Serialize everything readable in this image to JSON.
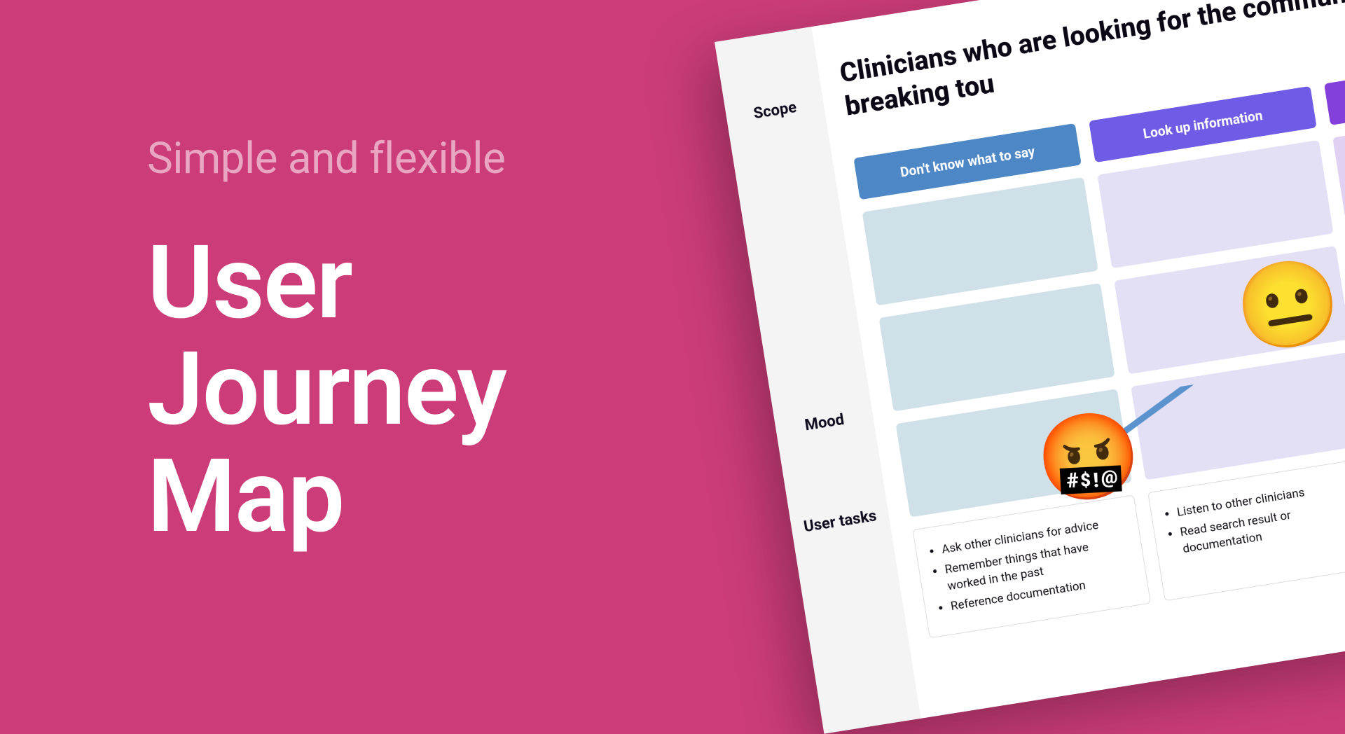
{
  "left": {
    "subtitle": "Simple and flexible",
    "title_l1": "User",
    "title_l2": "Journey",
    "title_l3": "Map"
  },
  "sidebar": {
    "scope": "Scope",
    "mood": "Mood",
    "tasks": "User tasks"
  },
  "scope_text": "Clinicians who are looking for the communicate when breaking tou",
  "columns": {
    "col1": "Don't know what to say",
    "col2": "Look up information",
    "col3": ""
  },
  "mood": {
    "emoji1": "🤬",
    "emoji2": "😐"
  },
  "tasks": {
    "col1": {
      "i1": "Ask other clinicians for advice",
      "i2": "Remember things that have worked in the past",
      "i3": "Reference documentation"
    },
    "col2": {
      "i1": "Listen to other clinicians",
      "i2": "Read search result or documentation"
    }
  }
}
